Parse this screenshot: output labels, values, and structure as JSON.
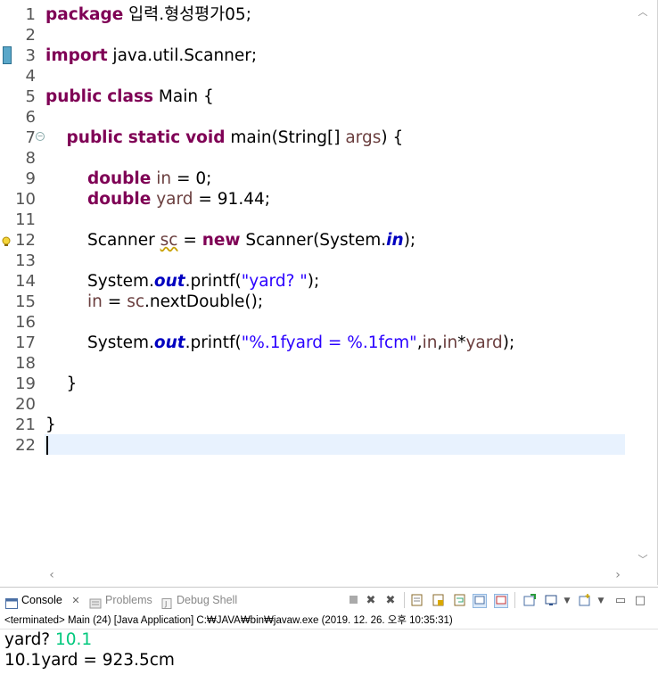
{
  "editor": {
    "lines": [
      {
        "n": "1",
        "tokens": [
          {
            "t": "package",
            "c": "kw"
          },
          {
            "t": " 입력.형성평가05;",
            "c": ""
          }
        ]
      },
      {
        "n": "2",
        "tokens": []
      },
      {
        "n": "3",
        "tokens": [
          {
            "t": "import",
            "c": "kw"
          },
          {
            "t": " java.util.Scanner;",
            "c": ""
          }
        ]
      },
      {
        "n": "4",
        "tokens": []
      },
      {
        "n": "5",
        "tokens": [
          {
            "t": "public",
            "c": "kw"
          },
          {
            "t": " ",
            "c": ""
          },
          {
            "t": "class",
            "c": "kw"
          },
          {
            "t": " Main {",
            "c": ""
          }
        ]
      },
      {
        "n": "6",
        "tokens": []
      },
      {
        "n": "7",
        "tokens": [
          {
            "t": "    ",
            "c": ""
          },
          {
            "t": "public",
            "c": "kw"
          },
          {
            "t": " ",
            "c": ""
          },
          {
            "t": "static",
            "c": "kw"
          },
          {
            "t": " ",
            "c": ""
          },
          {
            "t": "void",
            "c": "kw"
          },
          {
            "t": " main(String[] ",
            "c": ""
          },
          {
            "t": "args",
            "c": "var"
          },
          {
            "t": ") {",
            "c": ""
          }
        ]
      },
      {
        "n": "8",
        "tokens": []
      },
      {
        "n": "9",
        "tokens": [
          {
            "t": "        ",
            "c": ""
          },
          {
            "t": "double",
            "c": "kw"
          },
          {
            "t": " ",
            "c": ""
          },
          {
            "t": "in",
            "c": "var"
          },
          {
            "t": " = 0;",
            "c": ""
          }
        ]
      },
      {
        "n": "10",
        "tokens": [
          {
            "t": "        ",
            "c": ""
          },
          {
            "t": "double",
            "c": "kw"
          },
          {
            "t": " ",
            "c": ""
          },
          {
            "t": "yard",
            "c": "var"
          },
          {
            "t": " = 91.44;",
            "c": ""
          }
        ]
      },
      {
        "n": "11",
        "tokens": []
      },
      {
        "n": "12",
        "tokens": [
          {
            "t": "        Scanner ",
            "c": ""
          },
          {
            "t": "sc",
            "c": "var warnu"
          },
          {
            "t": " = ",
            "c": ""
          },
          {
            "t": "new",
            "c": "kw"
          },
          {
            "t": " Scanner(System.",
            "c": ""
          },
          {
            "t": "in",
            "c": "fld"
          },
          {
            "t": ");",
            "c": ""
          }
        ]
      },
      {
        "n": "13",
        "tokens": []
      },
      {
        "n": "14",
        "tokens": [
          {
            "t": "        System.",
            "c": ""
          },
          {
            "t": "out",
            "c": "fld"
          },
          {
            "t": ".printf(",
            "c": ""
          },
          {
            "t": "\"yard? \"",
            "c": "str"
          },
          {
            "t": ");",
            "c": ""
          }
        ]
      },
      {
        "n": "15",
        "tokens": [
          {
            "t": "        ",
            "c": ""
          },
          {
            "t": "in",
            "c": "var"
          },
          {
            "t": " = ",
            "c": ""
          },
          {
            "t": "sc",
            "c": "var"
          },
          {
            "t": ".nextDouble();",
            "c": ""
          }
        ]
      },
      {
        "n": "16",
        "tokens": []
      },
      {
        "n": "17",
        "tokens": [
          {
            "t": "        System.",
            "c": ""
          },
          {
            "t": "out",
            "c": "fld"
          },
          {
            "t": ".printf(",
            "c": ""
          },
          {
            "t": "\"%.1fyard = %.1fcm\"",
            "c": "str"
          },
          {
            "t": ",",
            "c": ""
          },
          {
            "t": "in",
            "c": "var"
          },
          {
            "t": ",",
            "c": ""
          },
          {
            "t": "in",
            "c": "var"
          },
          {
            "t": "*",
            "c": ""
          },
          {
            "t": "yard",
            "c": "var"
          },
          {
            "t": ");",
            "c": ""
          }
        ]
      },
      {
        "n": "18",
        "tokens": []
      },
      {
        "n": "19",
        "tokens": [
          {
            "t": "    }",
            "c": ""
          }
        ]
      },
      {
        "n": "20",
        "tokens": []
      },
      {
        "n": "21",
        "tokens": [
          {
            "t": "}",
            "c": ""
          }
        ]
      },
      {
        "n": "22",
        "tokens": []
      }
    ]
  },
  "console": {
    "tabs": [
      {
        "label": "Console",
        "state": "active",
        "icon": "console-icon"
      },
      {
        "label": "Problems",
        "state": "inactive",
        "icon": "problems-icon"
      },
      {
        "label": "Debug Shell",
        "state": "inactive",
        "icon": "debug-shell-icon"
      }
    ],
    "close_glyph": "✕",
    "status": "<terminated> Main (24) [Java Application] C:₩JAVA₩bin₩javaw.exe (2019. 12. 26. 오후 10:35:31)",
    "output": {
      "line1_prompt": "yard? ",
      "line1_input": "10.1",
      "line2": "10.1yard = 923.5cm"
    }
  },
  "colors": {
    "keyword": "#7f0055",
    "local_var": "#6a3e3e",
    "string": "#2a00ff",
    "static_field": "#0000c0",
    "console_input": "#00c87d",
    "current_line": "#e8f2fe"
  }
}
